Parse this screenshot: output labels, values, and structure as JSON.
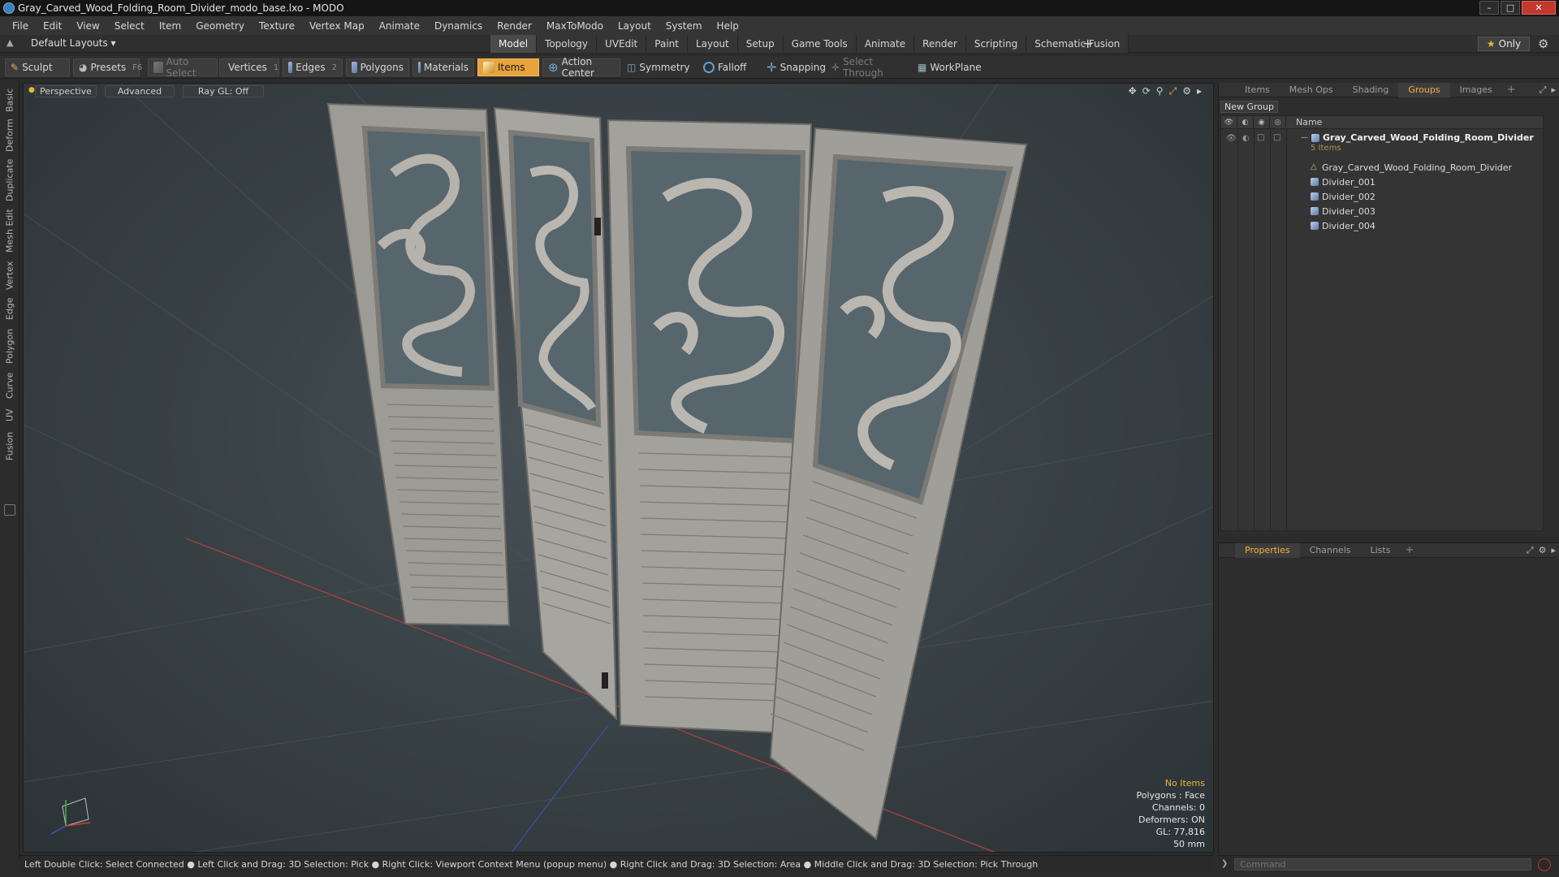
{
  "window": {
    "title": "Gray_Carved_Wood_Folding_Room_Divider_modo_base.lxo - MODO"
  },
  "menu": [
    "File",
    "Edit",
    "View",
    "Select",
    "Item",
    "Geometry",
    "Texture",
    "Vertex Map",
    "Animate",
    "Dynamics",
    "Render",
    "MaxToModo",
    "Layout",
    "System",
    "Help"
  ],
  "layoutbar": {
    "layout_select": "Default Layouts ▾",
    "tabs": [
      "Model",
      "Topology",
      "UVEdit",
      "Paint",
      "Layout",
      "Setup",
      "Game Tools",
      "Animate",
      "Render",
      "Scripting",
      "Schematic Fusion"
    ],
    "active_tab": "Model",
    "add_tab": "+",
    "only_label": "Only"
  },
  "toolbar": {
    "sculpt": "Sculpt",
    "presets": "Presets",
    "presets_key": "F6",
    "auto_select": "Auto Select",
    "vertices": "Vertices",
    "vertices_key": "1",
    "edges": "Edges",
    "edges_key": "2",
    "polygons": "Polygons",
    "materials": "Materials",
    "items": "Items",
    "action_center": "Action Center",
    "symmetry": "Symmetry",
    "falloff": "Falloff",
    "snapping": "Snapping",
    "select_through": "Select Through",
    "workplane": "WorkPlane"
  },
  "left_tabs": [
    "Basic",
    "Deform",
    "Duplicate",
    "Mesh Edit",
    "Vertex",
    "Edge",
    "Polygon",
    "Curve",
    "UV",
    "Fusion"
  ],
  "viewport": {
    "perspective": "Perspective",
    "advanced": "Advanced",
    "raygl": "Ray GL: Off",
    "info": {
      "no_items": "No Items",
      "polygons": "Polygons : Face",
      "channels": "Channels: 0",
      "deformers": "Deformers: ON",
      "gl": "GL: 77,816",
      "focal": "50 mm"
    }
  },
  "right_panel": {
    "tabs": [
      "Items",
      "Mesh Ops",
      "Shading",
      "Groups",
      "Images"
    ],
    "active_tab": "Groups",
    "add_tab": "+",
    "new_group": "New Group",
    "name_col": "Name",
    "group_name": "Gray_Carved_Wood_Folding_Room_Divider",
    "group_count": "5 Items",
    "children": [
      "Gray_Carved_Wood_Folding_Room_Divider",
      "Divider_001",
      "Divider_002",
      "Divider_003",
      "Divider_004"
    ]
  },
  "properties_panel": {
    "tabs": [
      "Properties",
      "Channels",
      "Lists"
    ],
    "active_tab": "Properties",
    "add_tab": "+"
  },
  "statusbar": {
    "text": "Left Double Click: Select Connected ● Left Click and Drag: 3D Selection: Pick ● Right Click: Viewport Context Menu (popup menu) ● Right Click and Drag: 3D Selection: Area ● Middle Click and Drag: 3D Selection: Pick Through"
  },
  "command": {
    "placeholder": "Command"
  },
  "colors": {
    "accent": "#e8a33a",
    "selected_text": "#f0b43c",
    "background": "#2b2b2b"
  }
}
